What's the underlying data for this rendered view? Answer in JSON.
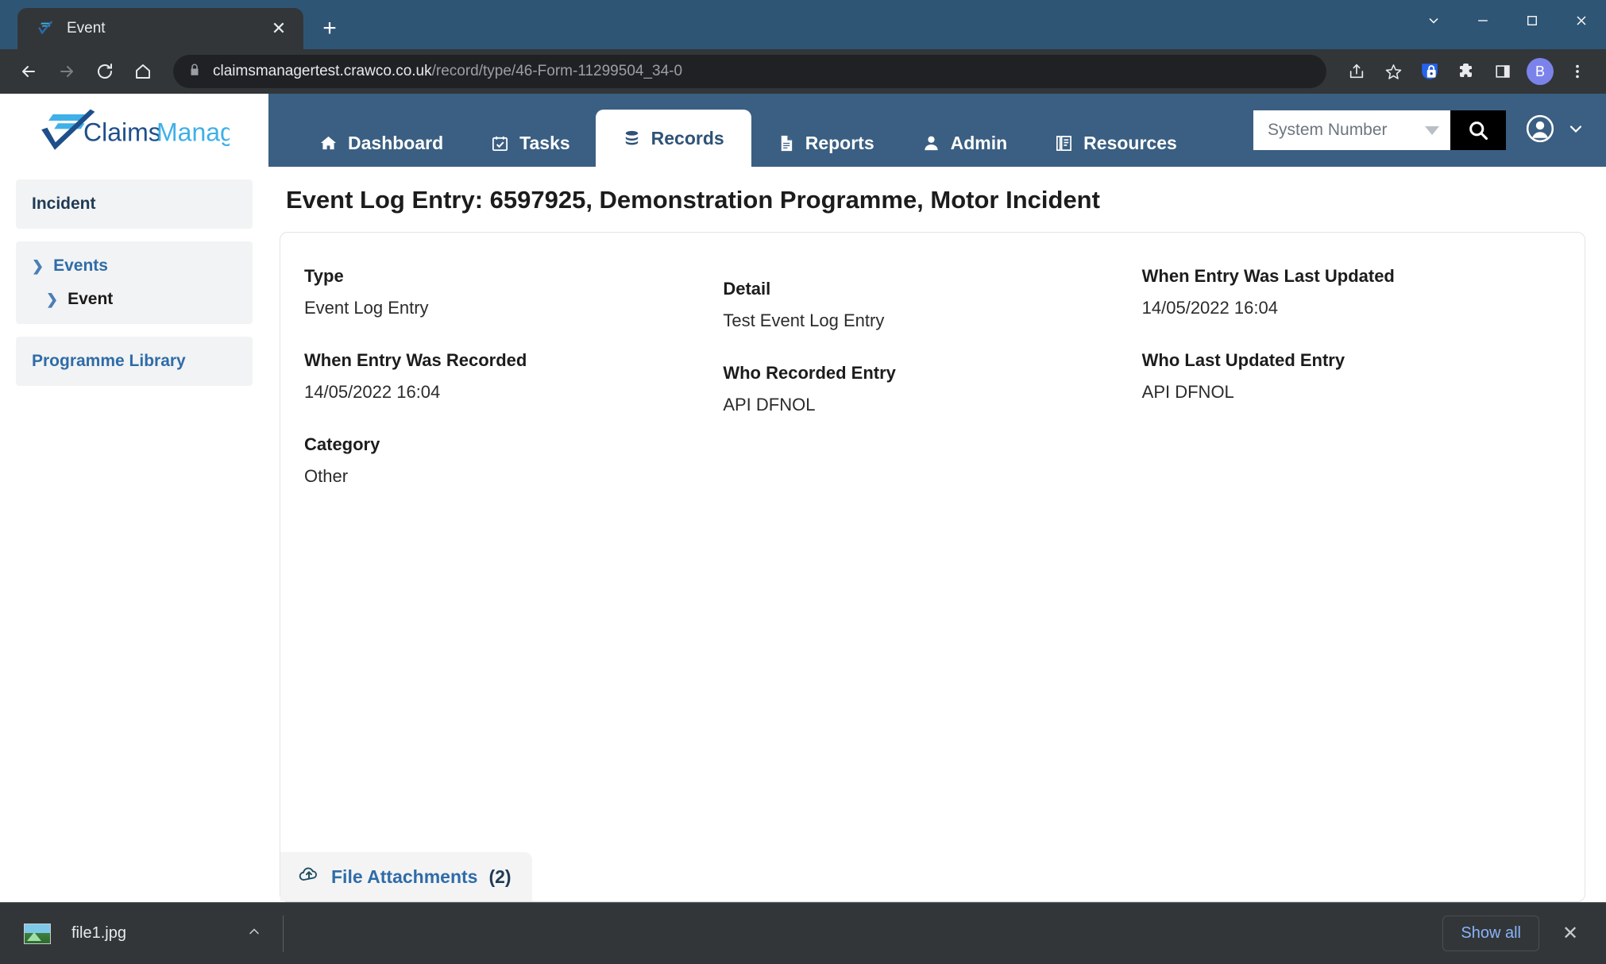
{
  "browser": {
    "tab": {
      "title": "Event",
      "favicon": "claimsmanager-check-icon",
      "close_label": "✕"
    },
    "newtab_label": "+",
    "window_controls": {
      "tab_search": "tab-search-chevron",
      "minimize": "minimize",
      "maximize": "maximize",
      "close": "close"
    },
    "nav": {
      "back": "back-arrow",
      "forward": "forward-arrow",
      "reload": "reload",
      "home": "home"
    },
    "omnibox": {
      "lock": "padlock-icon",
      "url_host": "claimsmanagertest.crawco.co.uk",
      "url_path": "/record/type/46-Form-11299504_34-0"
    },
    "toolbar_icons": [
      "share-icon",
      "bookmark-star-icon",
      "password-shield-extension-icon",
      "extensions-puzzle-icon",
      "side-panel-icon"
    ],
    "profile_initial": "B",
    "menu": "three-dot-menu-icon"
  },
  "app": {
    "logo": {
      "text_claims": "Claims",
      "text_manager": "Manager",
      "icon": "check-lines-icon"
    },
    "nav_tabs": [
      {
        "label": "Dashboard",
        "icon": "home-icon",
        "active": false
      },
      {
        "label": "Tasks",
        "icon": "calendar-check-icon",
        "active": false
      },
      {
        "label": "Records",
        "icon": "database-stack-icon",
        "active": true
      },
      {
        "label": "Reports",
        "icon": "document-icon",
        "active": false
      },
      {
        "label": "Admin",
        "icon": "user-icon",
        "active": false
      },
      {
        "label": "Resources",
        "icon": "book-library-icon",
        "active": false
      }
    ],
    "search": {
      "selected": "System Number",
      "dropdown_icon": "caret-down-icon",
      "button_icon": "search-magnifier-icon"
    },
    "user": {
      "avatar_icon": "user-circle-icon",
      "chevron_icon": "chevron-down-icon"
    }
  },
  "sidebar": {
    "groups": [
      {
        "items": [
          {
            "label": "Incident",
            "style": "title",
            "chevron": false
          }
        ]
      },
      {
        "items": [
          {
            "label": "Events",
            "style": "link",
            "chevron": true
          },
          {
            "label": "Event",
            "style": "current",
            "chevron": true
          }
        ]
      },
      {
        "items": [
          {
            "label": "Programme Library",
            "style": "link",
            "chevron": false
          }
        ]
      }
    ]
  },
  "page": {
    "title": "Event Log Entry: 6597925, Demonstration Programme, Motor Incident",
    "columns": [
      {
        "fields": [
          {
            "label": "Type",
            "value": "Event Log Entry"
          },
          {
            "label": "When Entry Was Recorded",
            "value": "14/05/2022 16:04"
          },
          {
            "label": "Category",
            "value": "Other"
          }
        ]
      },
      {
        "fields": [
          {
            "label": "Detail",
            "value": "Test Event Log Entry"
          },
          {
            "label": "Who Recorded Entry",
            "value": "API DFNOL"
          }
        ]
      },
      {
        "fields": [
          {
            "label": "When Entry Was Last Updated",
            "value": "14/05/2022 16:04"
          },
          {
            "label": "Who Last Updated Entry",
            "value": "API DFNOL"
          }
        ]
      }
    ],
    "attachments_tab": {
      "label": "File Attachments",
      "count": "(2)",
      "icon": "cloud-upload-icon"
    }
  },
  "downloads": {
    "file": {
      "name": "file1.jpg",
      "icon": "image-thumbnail-icon",
      "expand_icon": "chevron-up-icon"
    },
    "show_all_label": "Show all",
    "close_label": "✕"
  },
  "colors": {
    "header_blue": "#3a5f82",
    "chrome_blue": "#2f5575",
    "link_blue": "#2f6ca8",
    "navy": "#1f3a55",
    "accent_light_blue": "#3fb0e8"
  }
}
